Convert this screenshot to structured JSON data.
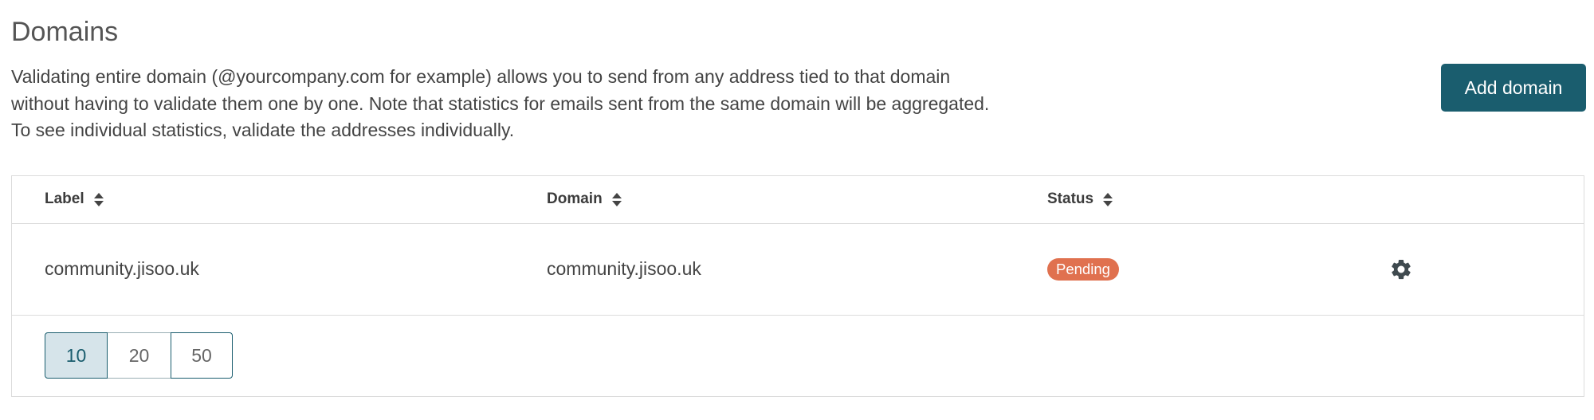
{
  "page": {
    "title": "Domains",
    "description_lines": [
      "Validating entire domain (@yourcompany.com for example) allows you to send from any address tied to that domain",
      "without having to validate them one by one. Note that statistics for emails sent from the same domain will be aggregated.",
      "To see individual statistics, validate the addresses individually."
    ],
    "add_button_label": "Add domain"
  },
  "table": {
    "columns": [
      "Label",
      "Domain",
      "Status"
    ],
    "rows": [
      {
        "label": "community.jisoo.uk",
        "domain": "community.jisoo.uk",
        "status": "Pending",
        "actions_icon": "gear-icon"
      }
    ]
  },
  "pagination": {
    "page_sizes": [
      "10",
      "20",
      "50"
    ],
    "selected": "10"
  },
  "colors": {
    "primary": "#1a5d6e",
    "status_pending": "#e0714f",
    "border": "#dcdcdc",
    "active_page_bg": "#d6e4ea"
  }
}
